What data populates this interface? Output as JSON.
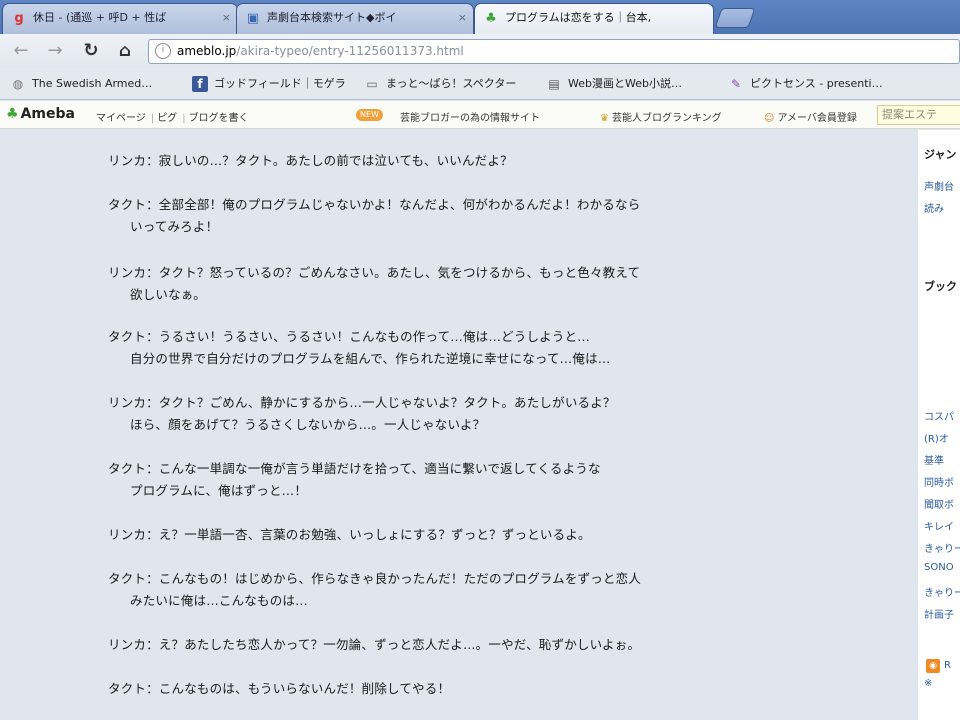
{
  "browser": {
    "tabs": [
      {
        "title": "休日 - (通巡 + 呼D + 性ば",
        "active": false,
        "icon": "google-icon"
      },
      {
        "title": "声劇台本検索サイト◆ボイ",
        "active": false,
        "icon": "page-icon"
      },
      {
        "title": "プログラムは恋をする｜台本, ",
        "active": true,
        "icon": "ameba-leaf-icon"
      }
    ],
    "close_glyph": "×",
    "url_host": "ameblo.jp",
    "url_path": "/akira-typeo/entry-11256011373.html"
  },
  "bookmarks": [
    {
      "label": "The Swedish Armed…",
      "icon": "globe-icon"
    },
    {
      "label": "ゴッドフィールド｜モゲラ",
      "icon": "facebook-icon"
    },
    {
      "label": "まっと～ばら！スペクター",
      "icon": "folder-icon"
    },
    {
      "label": "Web漫画とWeb小説…",
      "icon": "page-icon"
    },
    {
      "label": "ピクトセンス - presenti…",
      "icon": "pictsense-icon"
    }
  ],
  "ameba_bar": {
    "logo": "Ameba",
    "links": [
      "マイページ",
      "ピグ",
      "ブログを書く"
    ],
    "badge": "NEW",
    "promo": "芸能ブロガーの為の情報サイト",
    "ranking": "芸能人ブログランキング",
    "register": "アメーバ会員登録",
    "search_placeholder": "提案エステ"
  },
  "dialogue": [
    {
      "text": "リンカ：寂しいの…？タクト。あたしの前では泣いても、いいんだよ？",
      "cont": false
    },
    {
      "text": "タクト：全部全部！俺のプログラムじゃないかよ！なんだよ、何がわかるんだよ！わかるなら",
      "cont": false
    },
    {
      "text": "いってみろよ！",
      "cont": true
    },
    {
      "text": "リンカ：タクト？怒っているの？ごめんなさい。あたし、気をつけるから、もっと色々教えて",
      "cont": false
    },
    {
      "text": "欲しいなぁ。",
      "cont": true
    },
    {
      "text": "タクト：うるさい！うるさい、うるさい！こんなもの作って…俺は…どうしようと…",
      "cont": false
    },
    {
      "text": "自分の世界で自分だけのプログラムを組んで、作られた逆境に幸せになって…俺は…",
      "cont": true
    },
    {
      "text": "リンカ：タクト？ごめん、静かにするから…一人じゃないよ？タクト。あたしがいるよ？",
      "cont": false
    },
    {
      "text": "ほら、顔をあげて？うるさくしないから…。一人じゃないよ？",
      "cont": true
    },
    {
      "text": "タクト：こんな一単調な一俺が言う単語だけを拾って、適当に繋いで返してくるような",
      "cont": false
    },
    {
      "text": "プログラムに、俺はずっと…！",
      "cont": true
    },
    {
      "text": "リンカ：え？一単語一杏、言葉のお勉強、いっしょにする？ずっと？ずっといるよ。",
      "cont": false
    },
    {
      "text": "タクト：こんなもの！はじめから、作らなきゃ良かったんだ！ただのプログラムをずっと恋人",
      "cont": false
    },
    {
      "text": "みたいに俺は…こんなものは…",
      "cont": true
    },
    {
      "text": "リンカ：え？あたしたち恋人かって？一勿論、ずっと恋人だよ…。一やだ、恥ずかしいよぉ。",
      "cont": false
    },
    {
      "text": "タクト：こんなものは、もういらないんだ！削除してやる！",
      "cont": false
    }
  ],
  "sidebar": {
    "heading1": "ジャン",
    "links1": [
      "声劇台",
      "読み"
    ],
    "heading2": "ブック",
    "links2": [
      "コスパ",
      "(R)オ",
      "基準",
      "同時ボ",
      "聞取ボ",
      "キレイ",
      "きゃりー",
      "SONO",
      "きゃりー",
      "計画子"
    ],
    "rss_label": "R",
    "rss_sub": "※"
  }
}
